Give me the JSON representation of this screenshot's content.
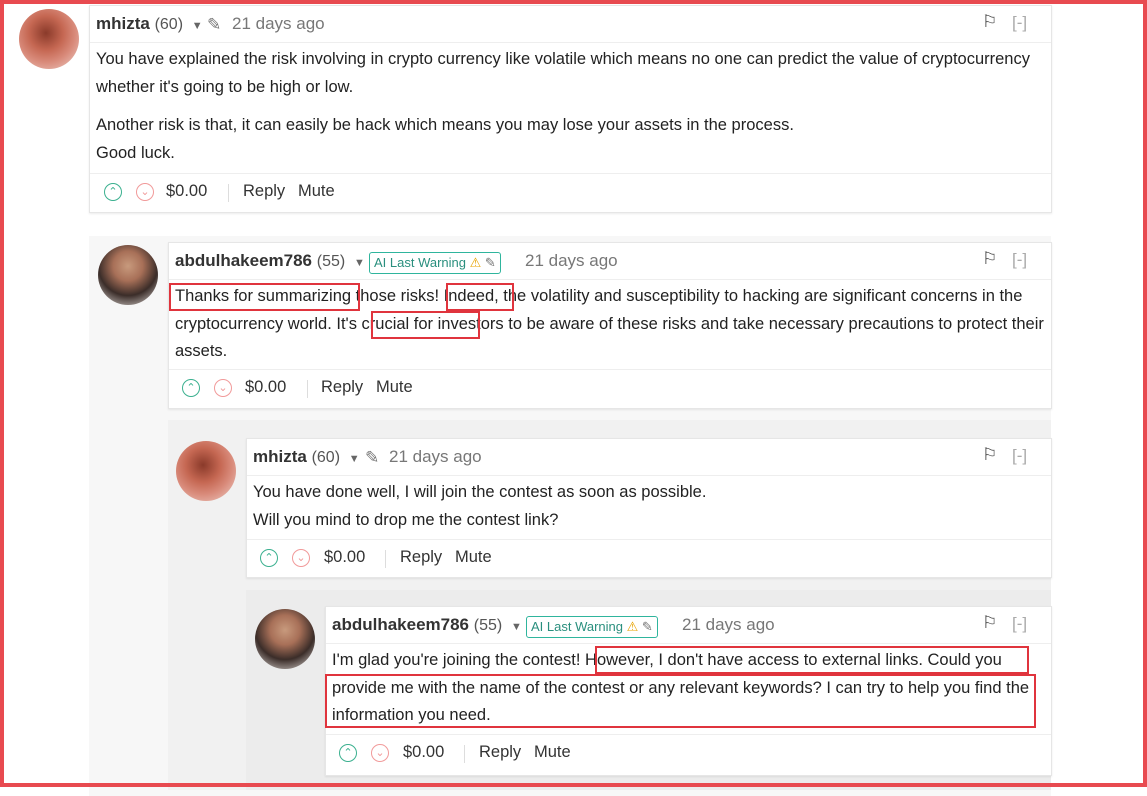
{
  "comments": [
    {
      "author": "mhizta",
      "rep": "(60)",
      "time": "21 days ago",
      "paragraphs": [
        "You have explained the risk involving in crypto currency like volatile which means no one can predict the value of cryptocurrency whether it's going to be high or low.",
        "Another risk is that, it can easily be hack which means you may lose your assets in the process.",
        "Good luck."
      ],
      "payout": "$0.00",
      "reply": "Reply",
      "mute": "Mute",
      "collapse": "[-]"
    },
    {
      "author": "abdulhakeem786",
      "rep": "(55)",
      "badge": "AI Last Warning",
      "time": "21 days ago",
      "paragraphs": [
        "Thanks for summarizing those risks! Indeed, the volatility and susceptibility to hacking are significant concerns in the cryptocurrency world. It's crucial for investors to be aware of these risks and take necessary precautions to protect their assets."
      ],
      "payout": "$0.00",
      "reply": "Reply",
      "mute": "Mute",
      "collapse": "[-]"
    },
    {
      "author": "mhizta",
      "rep": "(60)",
      "time": "21 days ago",
      "paragraphs": [
        "You have done well, I will join the contest as soon as possible.",
        "Will you mind to drop me the contest link?"
      ],
      "payout": "$0.00",
      "reply": "Reply",
      "mute": "Mute",
      "collapse": "[-]"
    },
    {
      "author": "abdulhakeem786",
      "rep": "(55)",
      "badge": "AI Last Warning",
      "time": "21 days ago",
      "paragraphs": [
        "I'm glad you're joining the contest! However, I don't have access to external links. Could you provide me with the name of the contest or any relevant keywords? I can try to help you find the information you need."
      ],
      "payout": "$0.00",
      "reply": "Reply",
      "mute": "Mute",
      "collapse": "[-]"
    }
  ],
  "icons": {
    "caret": "caret-down-icon",
    "pencil": "pencil-icon",
    "warning": "warning-icon",
    "flag": "flag-icon",
    "upvote": "chevron-up-icon",
    "downvote": "chevron-down-icon"
  },
  "colors": {
    "highlight": "#e0343d",
    "badge": "#2fb59d",
    "upvote": "#3bb08f",
    "downvote": "#f19a9a"
  }
}
